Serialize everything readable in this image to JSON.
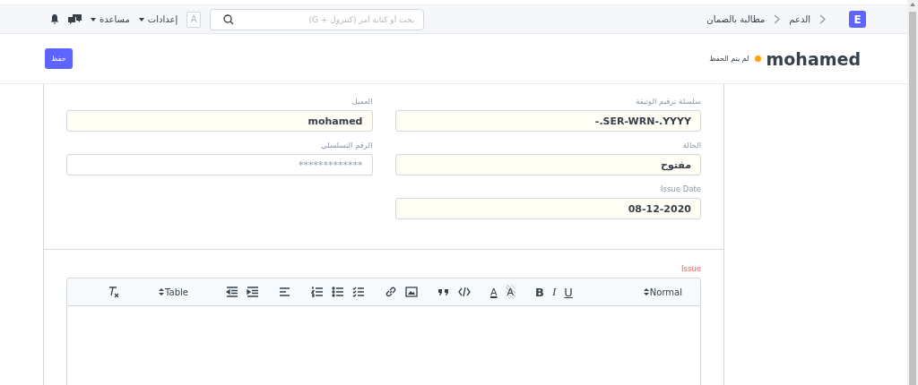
{
  "navbar": {
    "logo": "E",
    "breadcrumbs": [
      "الدعم",
      "مطالبة بالضمان"
    ],
    "search": {
      "placeholder": "بحث أو كتابة أمر (كنترول + G)"
    },
    "avatar": "A",
    "menus": [
      "إعدادات",
      "مساعدة"
    ]
  },
  "page_head": {
    "title": "mohamed",
    "unsaved": true,
    "indicator": "لم يتم الحفظ",
    "primary_button": "حفظ"
  },
  "form": {
    "columns": [
      [
        {
          "label": "سلسلة ترقيم الوثيقة",
          "value": "-.SER-WRN-.YYYY"
        },
        {
          "label": "الحالة",
          "value": "مفتوح"
        },
        {
          "label": "Issue Date",
          "value": "08-12-2020"
        }
      ],
      [
        {
          "label": "العميل",
          "value": "mohamed"
        },
        {
          "label": "الرقم التسلسلي",
          "placeholder": "*************"
        }
      ]
    ]
  },
  "editor": {
    "label": "Issue",
    "required": true,
    "toolbar": [
      [
        {
          "kind": "header",
          "label": "Normal"
        }
      ],
      [
        {
          "kind": "underline",
          "label": "U"
        },
        {
          "kind": "italic",
          "label": "I"
        },
        {
          "kind": "bold",
          "label": "B"
        }
      ],
      [
        {
          "kind": "background",
          "label": "A"
        },
        {
          "kind": "color",
          "label": "A"
        }
      ],
      [
        {
          "kind": "code"
        },
        {
          "kind": "quote"
        }
      ],
      [
        {
          "kind": "image"
        },
        {
          "kind": "link"
        }
      ],
      [
        {
          "kind": "checklist"
        },
        {
          "kind": "bullet"
        },
        {
          "kind": "ordered"
        }
      ],
      [
        {
          "kind": "align"
        }
      ],
      [
        {
          "kind": "indent"
        },
        {
          "kind": "outdent"
        }
      ],
      [
        {
          "kind": "table",
          "label": "Table"
        }
      ],
      [
        {
          "kind": "clean"
        }
      ]
    ]
  }
}
